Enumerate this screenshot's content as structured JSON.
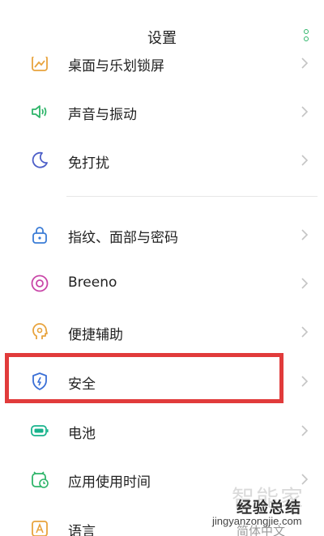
{
  "header": {
    "title": "设置",
    "more_icon": "more-vertical-icon"
  },
  "settings": {
    "items": [
      {
        "label": "桌面与乐划锁屏",
        "icon": "desktop-icon",
        "color": "#e8a33d"
      },
      {
        "label": "声音与振动",
        "icon": "sound-icon",
        "color": "#2fb56a"
      },
      {
        "label": "免打扰",
        "icon": "moon-icon",
        "color": "#4d5fc8"
      },
      {
        "label": "指纹、面部与密码",
        "icon": "lock-icon",
        "color": "#3a7cd6"
      },
      {
        "label": "Breeno",
        "icon": "breeno-icon",
        "color": "#c946a8"
      },
      {
        "label": "便捷辅助",
        "icon": "assist-icon",
        "color": "#e8a33d"
      },
      {
        "label": "安全",
        "icon": "shield-icon",
        "color": "#3a6fd6"
      },
      {
        "label": "电池",
        "icon": "battery-icon",
        "color": "#18b38c"
      },
      {
        "label": "应用使用时间",
        "icon": "app-time-icon",
        "color": "#2fb56a"
      },
      {
        "label": "语言",
        "icon": "language-icon",
        "color": "#e8a33d"
      }
    ],
    "language_value": "简体中文"
  },
  "highlight": {
    "color": "#e13b3b"
  },
  "watermark": {
    "chars": "智能家",
    "logo": "经验总结",
    "url": "jingyanzongjie.com"
  }
}
